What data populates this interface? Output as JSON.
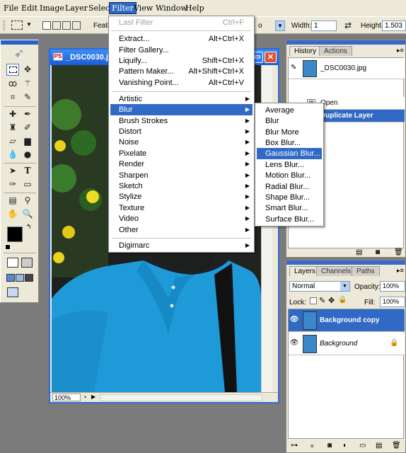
{
  "menubar": {
    "items": [
      "File",
      "Edit",
      "Image",
      "Layer",
      "Select",
      "Filter",
      "View",
      "Window",
      "Help"
    ]
  },
  "options": {
    "feather_label": "Feath",
    "style_value_tail": "o",
    "width_label": "Width:",
    "width_value": "1",
    "height_label": "Height:",
    "height_value": "1.503"
  },
  "document": {
    "title": "_DSC0030.jpg",
    "zoom": "100%"
  },
  "filter_menu": {
    "items": [
      {
        "label": "Last Filter",
        "shortcut": "Ctrl+F",
        "disabled": true
      },
      {
        "label": "Extract...",
        "shortcut": "Alt+Ctrl+X"
      },
      {
        "label": "Filter Gallery...",
        "shortcut": ""
      },
      {
        "label": "Liquify...",
        "shortcut": "Shift+Ctrl+X"
      },
      {
        "label": "Pattern Maker...",
        "shortcut": "Alt+Shift+Ctrl+X"
      },
      {
        "label": "Vanishing Point...",
        "shortcut": "Alt+Ctrl+V"
      },
      {
        "label": "Artistic"
      },
      {
        "label": "Blur"
      },
      {
        "label": "Brush Strokes"
      },
      {
        "label": "Distort"
      },
      {
        "label": "Noise"
      },
      {
        "label": "Pixelate"
      },
      {
        "label": "Render"
      },
      {
        "label": "Sharpen"
      },
      {
        "label": "Sketch"
      },
      {
        "label": "Stylize"
      },
      {
        "label": "Texture"
      },
      {
        "label": "Video"
      },
      {
        "label": "Other"
      },
      {
        "label": "Digimarc"
      }
    ]
  },
  "blur_menu": {
    "items": [
      "Average",
      "Blur",
      "Blur More",
      "Box Blur...",
      "Gaussian Blur...",
      "Lens Blur...",
      "Motion Blur...",
      "Radial Blur...",
      "Shape Blur...",
      "Smart Blur...",
      "Surface Blur..."
    ]
  },
  "history": {
    "tabs": [
      "History",
      "Actions"
    ],
    "snapshot": "_DSC0030.jpg",
    "states": [
      "Open",
      "Duplicate Layer"
    ]
  },
  "layers": {
    "tabs": [
      "Layers",
      "Channels",
      "Paths"
    ],
    "blend_mode": "Normal",
    "opacity_label": "Opacity:",
    "opacity_value": "100%",
    "lock_label": "Lock:",
    "fill_label": "Fill:",
    "fill_value": "100%",
    "items": [
      "Background copy",
      "Background"
    ]
  },
  "colors": {
    "accent": "#316ac5",
    "title": "#1d5bd6",
    "shirt": "#1e9ad8"
  }
}
